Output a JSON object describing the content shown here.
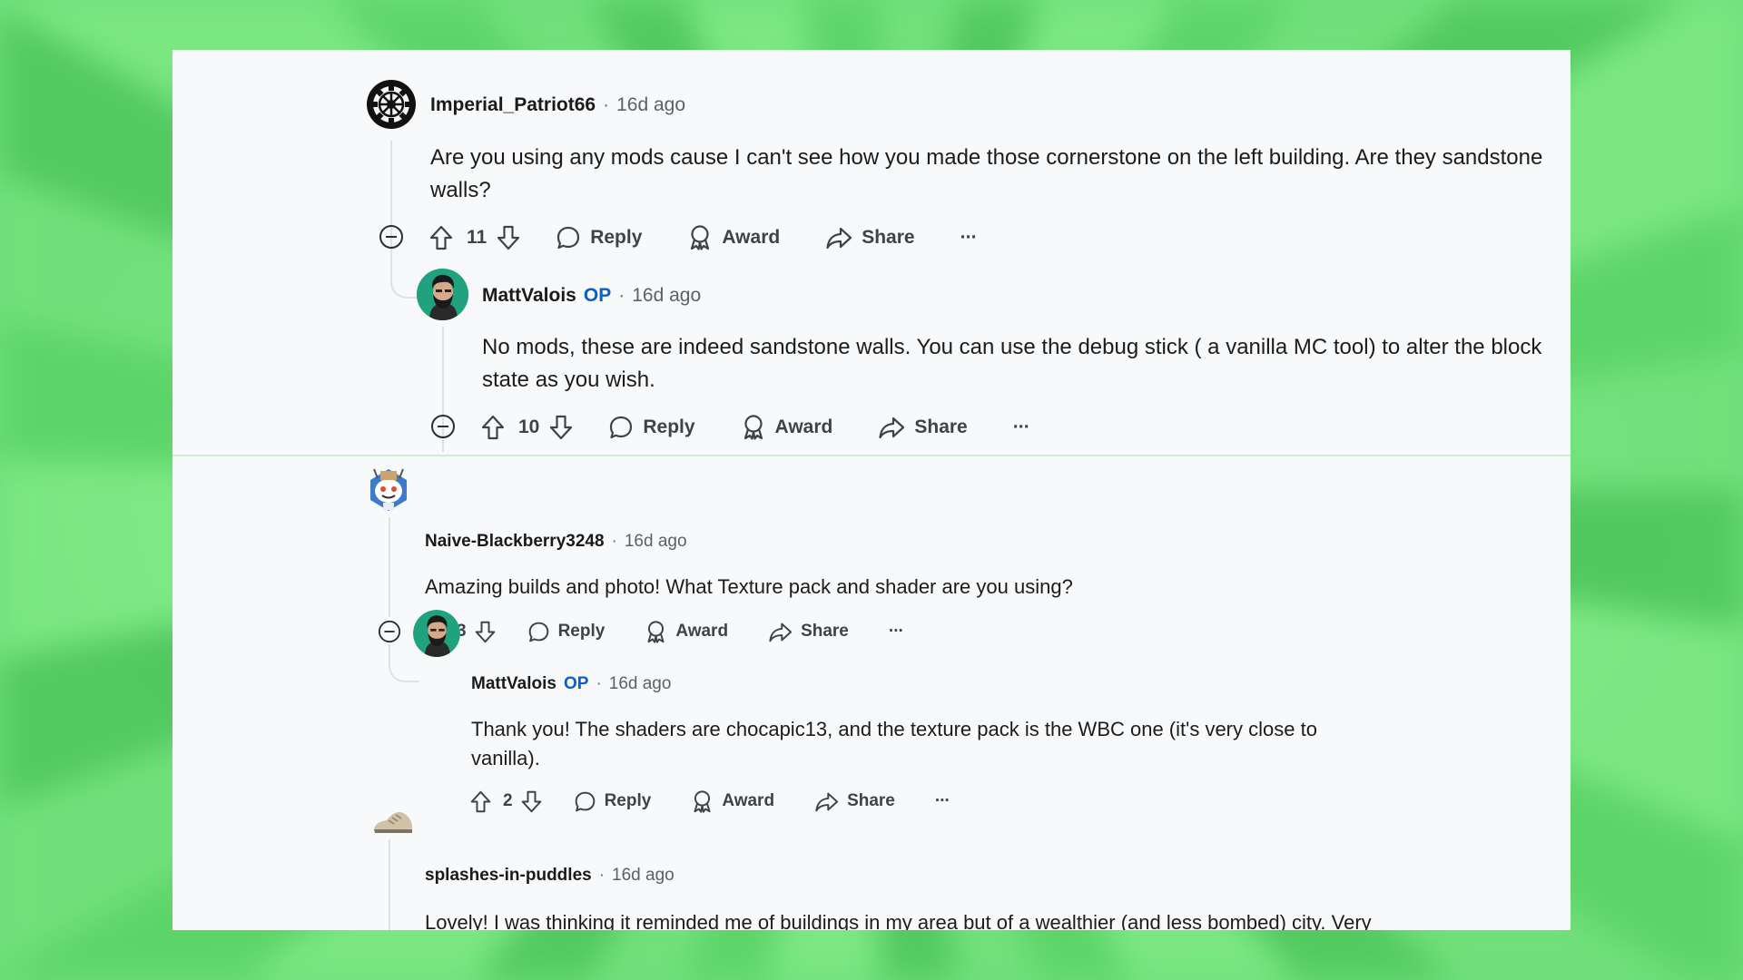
{
  "theme": {
    "op_color": "#0b5fc6",
    "text_color": "#1c1c1c",
    "meta_color": "#5b6167",
    "card_bg": "#f8f9fa",
    "background": "#6fe07a"
  },
  "comments": [
    {
      "author": "Imperial_Patriot66",
      "op_label": "",
      "separator": "·",
      "time": "16d ago",
      "text": "Are you using any mods cause I can't see how you made those cornerstone on the left building. Are they sandstone walls?",
      "votes": "11",
      "reply_label": "Reply",
      "award_label": "Award",
      "share_label": "Share",
      "more_label": "···",
      "avatar_icon": "galactic-empire-emblem"
    },
    {
      "author": "MattValois",
      "op_label": "OP",
      "separator": "·",
      "time": "16d ago",
      "text": "No mods, these are indeed sandstone walls. You can use the debug stick ( a vanilla MC tool) to alter the block state as you wish.",
      "votes": "10",
      "reply_label": "Reply",
      "award_label": "Award",
      "share_label": "Share",
      "more_label": "···",
      "avatar_icon": "bearded-man-portrait"
    },
    {
      "author": "Naive-Blackberry3248",
      "op_label": "",
      "separator": "·",
      "time": "16d ago",
      "text": "Amazing builds and photo! What Texture pack and shader are you using?",
      "votes": "3",
      "reply_label": "Reply",
      "award_label": "Award",
      "share_label": "Share",
      "more_label": "···",
      "avatar_icon": "snoo-avatar"
    },
    {
      "author": "MattValois",
      "op_label": "OP",
      "separator": "·",
      "time": "16d ago",
      "text": "Thank you! The shaders are chocapic13, and the texture pack is the WBC one (it's very close to vanilla).",
      "votes": "2",
      "reply_label": "Reply",
      "award_label": "Award",
      "share_label": "Share",
      "more_label": "···",
      "avatar_icon": "bearded-man-portrait"
    },
    {
      "author": "splashes-in-puddles",
      "op_label": "",
      "separator": "·",
      "time": "16d ago",
      "text": "Lovely! I was thinking it reminded me of buildings in my area but of a wealthier (and less bombed) city. Very cool!",
      "avatar_icon": "sneaker-avatar"
    }
  ]
}
